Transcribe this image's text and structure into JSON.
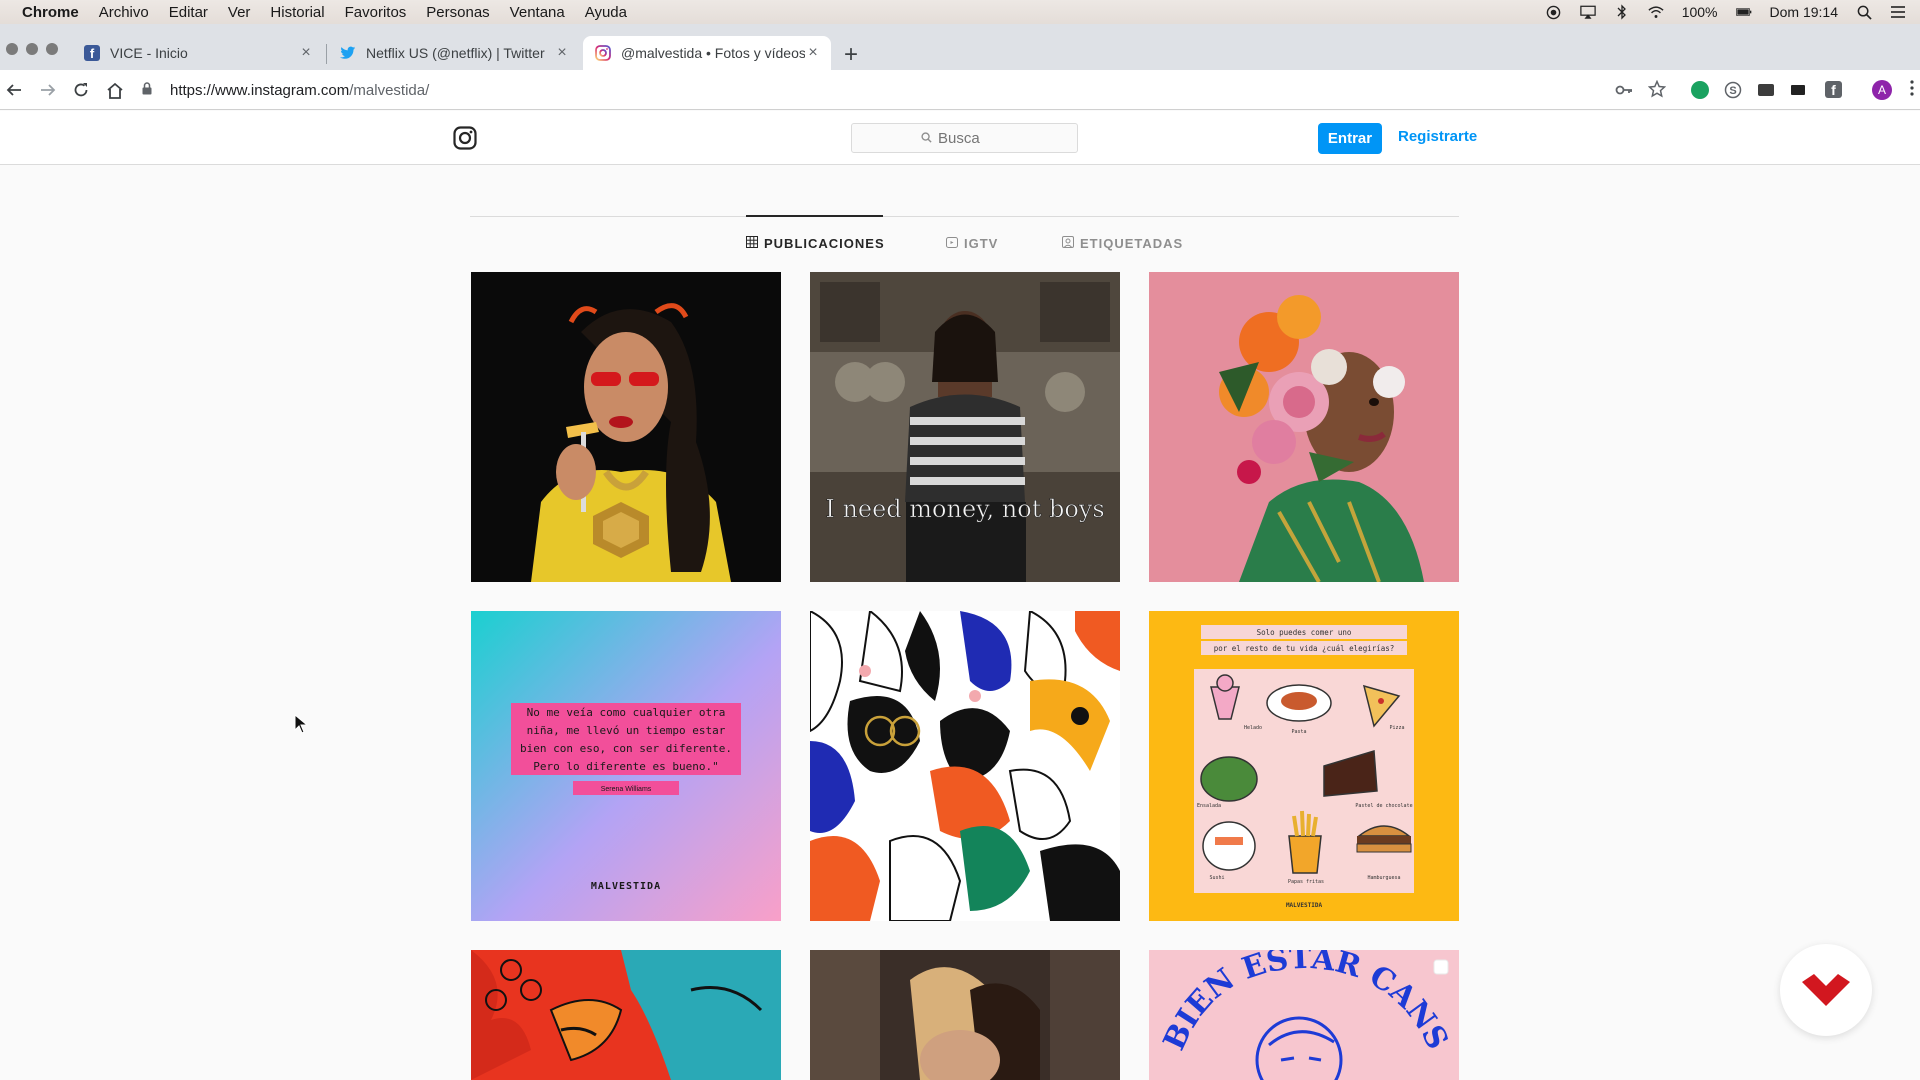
{
  "menubar": {
    "app": "Chrome",
    "items": [
      "Archivo",
      "Editar",
      "Ver",
      "Historial",
      "Favoritos",
      "Personas",
      "Ventana",
      "Ayuda"
    ],
    "battery": "100%",
    "clock": "Dom 19:14"
  },
  "tabs": [
    {
      "title": "VICE - Inicio",
      "favicon": "facebook-icon"
    },
    {
      "title": "Netflix US (@netflix) | Twitter",
      "favicon": "twitter-icon"
    },
    {
      "title": "@malvestida • Fotos y vídeos d",
      "favicon": "instagram-icon",
      "active": true
    }
  ],
  "omnibox": {
    "host": "https://www.instagram.com",
    "path": "/malvestida/"
  },
  "instagram": {
    "search_placeholder": "Busca",
    "login_label": "Entrar",
    "signup_label": "Registrarte",
    "profile_tabs": [
      "PUBLICACIONES",
      "IGTV",
      "ETIQUETADAS"
    ],
    "posts": {
      "p2_caption": "I need money, not boys",
      "p4_quote": [
        "No me veía como cualquier otra",
        "niña, me llevó un tiempo estar",
        "bien con eso, con ser diferente.",
        "Pero lo diferente es bueno.\""
      ],
      "p4_author": "Serena Williams",
      "p4_brand": "MALVESTIDA",
      "p6_header": [
        "Solo puedes comer uno",
        "por el resto de tu vida ¿cuál elegirías?"
      ],
      "p6_items": [
        "Helado",
        "Pasta",
        "Pizza",
        "Ensalada",
        "Pastel de chocolate",
        "Sushi",
        "Papas fritas",
        "Hamburguesa"
      ],
      "p6_brand": "MALVESTIDA",
      "p9_text": "BIEN ESTAR CANSADA"
    }
  },
  "colors": {
    "ig_blue": "#0095f6",
    "brand_red": "#d2171f"
  }
}
